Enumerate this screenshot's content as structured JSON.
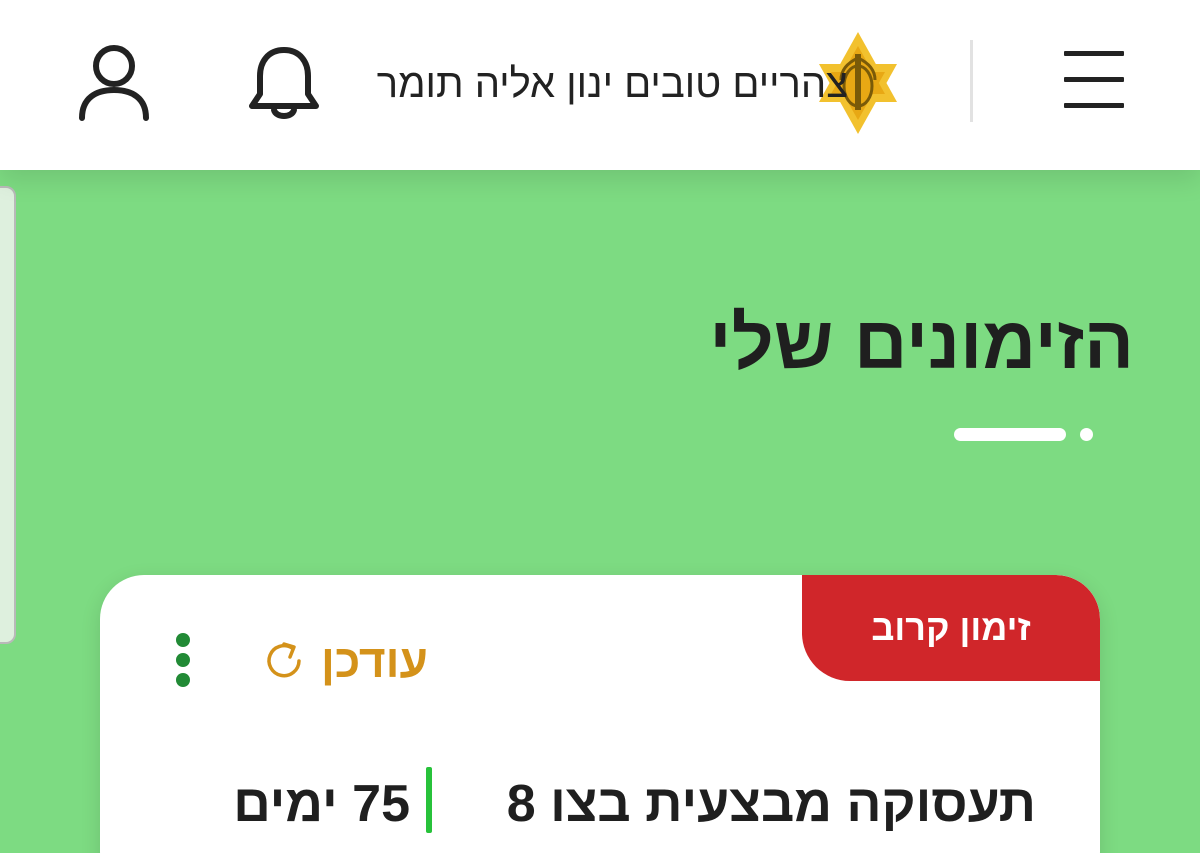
{
  "header": {
    "greeting": "צהריים טובים ינון אליה תומר",
    "menu_icon": "hamburger-menu-icon",
    "logo": "idf-emblem-logo",
    "notification_icon": "bell-icon",
    "profile_icon": "user-profile-icon"
  },
  "page": {
    "title": "הזימונים שלי"
  },
  "card": {
    "badge": "זימון קרוב",
    "status": "עודכן",
    "status_icon": "refresh-icon",
    "options_icon": "kebab-menu-icon",
    "title": "תעסוקה מבצעית בצו 8",
    "duration": "75 ימים"
  },
  "colors": {
    "background": "#7ddb82",
    "badge": "#d0262a",
    "status": "#d4921a",
    "accent": "#27c23a",
    "options": "#218a35"
  }
}
